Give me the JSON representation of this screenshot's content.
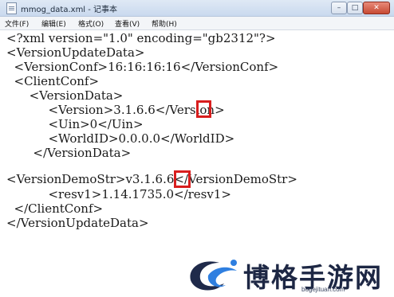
{
  "window": {
    "title": "mmog_data.xml - 记事本",
    "min_symbol": "–",
    "max_symbol": "□",
    "close_symbol": "✕"
  },
  "menu": [
    "文件(F)",
    "编辑(E)",
    "格式(O)",
    "查看(V)",
    "帮助(H)"
  ],
  "editor": {
    "lines": [
      "<?xml version=\"1.0\" encoding=\"gb2312\"?>",
      "<VersionUpdateData>",
      "  <VersionConf>16:16:16:16</VersionConf>",
      "  <ClientConf>",
      "      <VersionData>",
      "           <Version>3.1.6.6</Version>",
      "           <Uin>0</Uin>",
      "           <WorldID>0.0.0.0</WorldID>",
      "       </VersionData>",
      "",
      "<VersionDemoStr>v3.1.6.6</VersionDemoStr>",
      "           <resv1>1.14.1735.0</resv1>",
      "  </ClientConf>",
      "</VersionUpdateData>"
    ]
  },
  "watermark": {
    "brand": "博格手游网",
    "url": "bogejituan.com"
  },
  "colors": {
    "highlight": "#d81e1e",
    "logo_dark": "#1f2a4a",
    "logo_accent": "#2f7fe0"
  }
}
